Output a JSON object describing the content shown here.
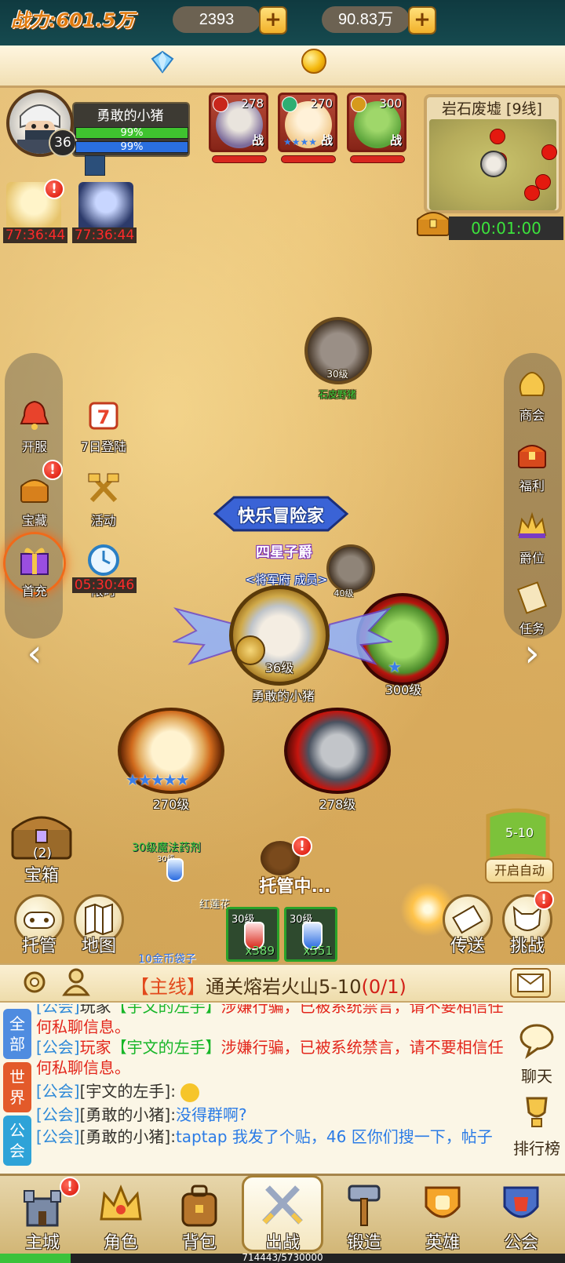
{
  "resources": {
    "power": "战力:601.5万",
    "diamonds": "2393",
    "gold": "90.83万"
  },
  "player": {
    "name": "勇敢的小猪",
    "level": "36",
    "hp_percent": "99%",
    "mp_percent": "99%"
  },
  "team": [
    {
      "level": "278",
      "fight": "战",
      "color": "#7b6a9a",
      "stars": ""
    },
    {
      "level": "270",
      "fight": "战",
      "color": "#f1c98a",
      "stars": "★★★★"
    },
    {
      "level": "300",
      "fight": "战",
      "color": "#5aa33a",
      "stars": ""
    }
  ],
  "minimap": {
    "title": "岩石废墟 [9线]",
    "timer": "00:01:00"
  },
  "timers": {
    "hero1": "77:36:44",
    "hero2": "77:36:44",
    "first_charge": "05:30:46",
    "limited_label": "限时"
  },
  "left_menu": [
    {
      "label": "开服",
      "icon": "bell-icon"
    },
    {
      "label": "7日登陆",
      "icon": "calendar-7-icon",
      "badge": "7"
    },
    {
      "label": "宝藏",
      "icon": "treasure-icon"
    },
    {
      "label": "活动",
      "icon": "hammers-icon"
    },
    {
      "label": "首充",
      "icon": "gift-icon"
    },
    {
      "label": "限时",
      "icon": "clock-icon"
    }
  ],
  "right_menu": [
    {
      "label": "商会",
      "icon": "money-bag-icon"
    },
    {
      "label": "福利",
      "icon": "chest-icon"
    },
    {
      "label": "爵位",
      "icon": "crown-icon"
    },
    {
      "label": "任务",
      "icon": "scroll-icon"
    }
  ],
  "map": {
    "monster_level": "30级",
    "monster_name": "石皮野猪",
    "player_title": "快乐冒险家",
    "player_rank": "四星子爵",
    "player_guild": "<将军府 成员>",
    "player_level": "36级",
    "player_name": "勇敢的小猪",
    "ally_green_level": "300级",
    "ally_blonde_level": "270级",
    "ally_dark_level": "278级",
    "hidden_level": "40级",
    "potion_tag": "30级魔法药剂",
    "potion_small": "30级",
    "red_tag": "红莲花",
    "bag_tag": "10金币袋子",
    "auto_text": "托管中..."
  },
  "lower_buttons": {
    "chest_count": "(2)",
    "chest_label": "宝箱",
    "host": "托管",
    "map": "地图",
    "teleport": "传送",
    "challenge": "挑战",
    "stage": "5-10",
    "auto_start": "开启自动"
  },
  "potions": [
    {
      "level": "30级",
      "qty": "x389",
      "color": "#d8281a"
    },
    {
      "level": "30级",
      "qty": "x551",
      "color": "#2a6be0"
    }
  ],
  "quest": {
    "tag": "【主线】",
    "text": "通关熔岩火山5-10",
    "count": "(0/1)"
  },
  "chat": {
    "tabs": [
      "全部",
      "世界",
      "公会"
    ],
    "lines": [
      {
        "prefix": "[公会]",
        "who": "玩家",
        "name": "【宇文的左手】",
        "body": "涉嫌行骗，已被系统禁言，请不要相信任何私聊信息。"
      },
      {
        "prefix": "[公会]",
        "who": "玩家",
        "name": "【宇文的左手】",
        "body": "涉嫌行骗，已被系统禁言，请不要相信任何私聊信息。"
      },
      {
        "prefix": "[公会]",
        "who": "[宇文的左手]:",
        "name": "",
        "body": ""
      },
      {
        "prefix": "[公会]",
        "who": "[勇敢的小猪]:",
        "name": "",
        "body": "没得群啊?"
      },
      {
        "prefix": "[公会]",
        "who": "[勇敢的小猪]:",
        "name": "",
        "body": "taptap 我发了个贴，46 区你们搜一下，帖子"
      }
    ],
    "side": [
      "聊天",
      "排行榜"
    ]
  },
  "nav": [
    {
      "label": "主城",
      "icon": "castle-icon"
    },
    {
      "label": "角色",
      "icon": "crown-icon"
    },
    {
      "label": "背包",
      "icon": "backpack-icon"
    },
    {
      "label": "出战",
      "icon": "crossed-swords-icon"
    },
    {
      "label": "锻造",
      "icon": "hammer-icon"
    },
    {
      "label": "英雄",
      "icon": "fist-shield-icon"
    },
    {
      "label": "公会",
      "icon": "guild-shield-icon"
    }
  ],
  "exp": {
    "text": "714443/5730000",
    "fraction": 0.125
  }
}
